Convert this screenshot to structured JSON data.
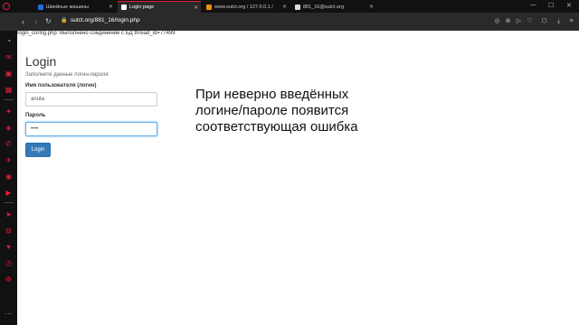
{
  "tabs": [
    {
      "label": "Швейные машины",
      "active": false
    },
    {
      "label": "Login page",
      "active": true
    },
    {
      "label": "www.sutct.org / 127.0.0.1 /",
      "active": false
    },
    {
      "label": "881_16@sutct.org",
      "active": false
    }
  ],
  "address_bar": {
    "url": "sutct.org/881_16/login.php"
  },
  "page": {
    "status_line": "login_config.php: Выполнено соединение с БД thread_id=77499",
    "title": "Login",
    "subtitle": "Заполните данные логин-пароля",
    "username_label": "Имя пользователя (логин)",
    "username_value": "anuta",
    "password_label": "Пароль",
    "password_value": "••••",
    "login_button": "Login",
    "note_lines": [
      "При неверно введённых",
      "логине/пароле появится",
      "соответствующая ошибка"
    ]
  },
  "colors": {
    "accent": "#e51b3d",
    "button": "#337ab7",
    "focus": "#66afe9"
  }
}
